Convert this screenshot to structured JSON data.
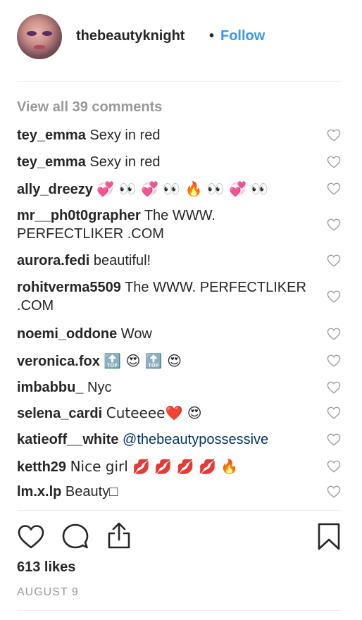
{
  "post": {
    "username": "thebeautyknight",
    "separator": "•",
    "follow_label": "Follow",
    "view_all_label": "View all 39 comments",
    "likes_label": "613 likes",
    "date_label": "AUGUST 9"
  },
  "comments": [
    {
      "user": "tey_emma",
      "text": "Sexy in red"
    },
    {
      "user": "tey_emma",
      "text": "Sexy in red"
    },
    {
      "user": "ally_dreezy",
      "text": "💞 👀 💞 👀 🔥 👀 💞 👀"
    },
    {
      "user": "mr__ph0t0grapher",
      "text": "The WWW. PERFECTLIKER .COM"
    },
    {
      "user": "aurora.fedi",
      "text": "beautiful!"
    },
    {
      "user": "rohitverma5509",
      "text": "The WWW. PERFECTLIKER .COM"
    },
    {
      "user": "noemi_oddone",
      "text": "Wow"
    },
    {
      "user": "veronica.fox",
      "text": "🔝 😍 🔝 😍"
    },
    {
      "user": "imbabbu_",
      "text": "Nyc"
    },
    {
      "user": "selena_cardi",
      "text": "Cuteeee❤️ 😍"
    },
    {
      "user": "katieoff__white",
      "mention": "@thebeautypossessive"
    },
    {
      "user": "ketth29",
      "text": "Nice girl 💋 💋 💋 💋 🔥"
    },
    {
      "user": "lm.x.lp",
      "text": "Beauty□"
    }
  ],
  "icons": {
    "like": "heart-icon",
    "comment": "speech-bubble-icon",
    "share": "share-upload-icon",
    "save": "bookmark-icon",
    "comment_like": "heart-outline-icon"
  },
  "colors": {
    "link": "#3897f0",
    "mention": "#003569",
    "muted": "#999999",
    "text": "#262626"
  }
}
